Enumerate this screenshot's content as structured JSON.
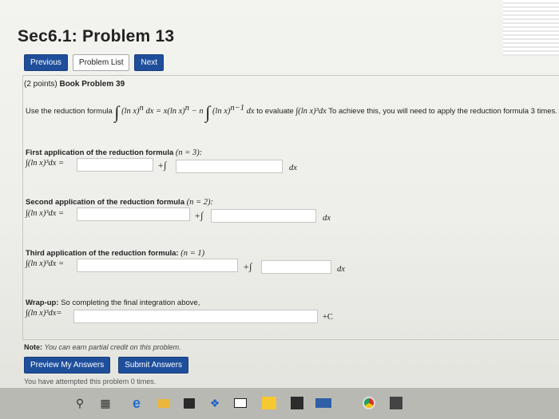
{
  "page": {
    "title": "Sec6.1: Problem 13",
    "nav": {
      "previous": "Previous",
      "problem_list": "Problem List",
      "next": "Next"
    },
    "points": "(2 points)",
    "problem_name": "Book Problem 39",
    "intro_prefix": "Use the reduction formula",
    "reduction_formula_lhs": "(ln x)",
    "reduction_formula_mid": "dx = x(ln x)",
    "reduction_formula_minus_n": "− n",
    "reduction_formula_tail": "(ln x)",
    "reduction_formula_dx": "dx",
    "to_evaluate": "to evaluate",
    "target_integral": "∫(ln x)³dx",
    "intro_suffix": "To achieve this, you will need to apply the reduction formula 3 times.",
    "steps": [
      {
        "label": "First application of the reduction formula",
        "n": "(n = 3):",
        "expr": "∫(ln x)³dx =",
        "plus": "+∫",
        "dx": "dx"
      },
      {
        "label": "Second application of the reduction formula",
        "n": "(n = 2):",
        "expr": "∫(ln x)³dx =",
        "plus": "+∫",
        "dx": "dx"
      },
      {
        "label": "Third application of the reduction formula:",
        "n": "(n = 1)",
        "expr": "∫(ln x)³dx =",
        "plus": "+∫",
        "dx": "dx"
      }
    ],
    "wrapup": {
      "label": "Wrap-up:",
      "text": "So completing the final integration above,",
      "expr": "∫(ln x)³dx=",
      "plus_c": "+C"
    },
    "note_label": "Note:",
    "note_text": "You can earn partial credit on this problem.",
    "preview_button": "Preview My Answers",
    "submit_button": "Submit Answers",
    "attempts": "You have attempted this problem 0 times."
  },
  "taskbar": {
    "icons": [
      "search-icon",
      "task-view-icon",
      "edge-icon",
      "file-explorer-icon",
      "store-icon",
      "dropbox-icon",
      "mail-icon",
      "app-a-icon",
      "app-j-icon",
      "app-news-icon",
      "chrome-icon",
      "settings-icon"
    ]
  },
  "colors": {
    "button_blue": "#1f4f9b",
    "page_bg": "#f3f3ef"
  }
}
